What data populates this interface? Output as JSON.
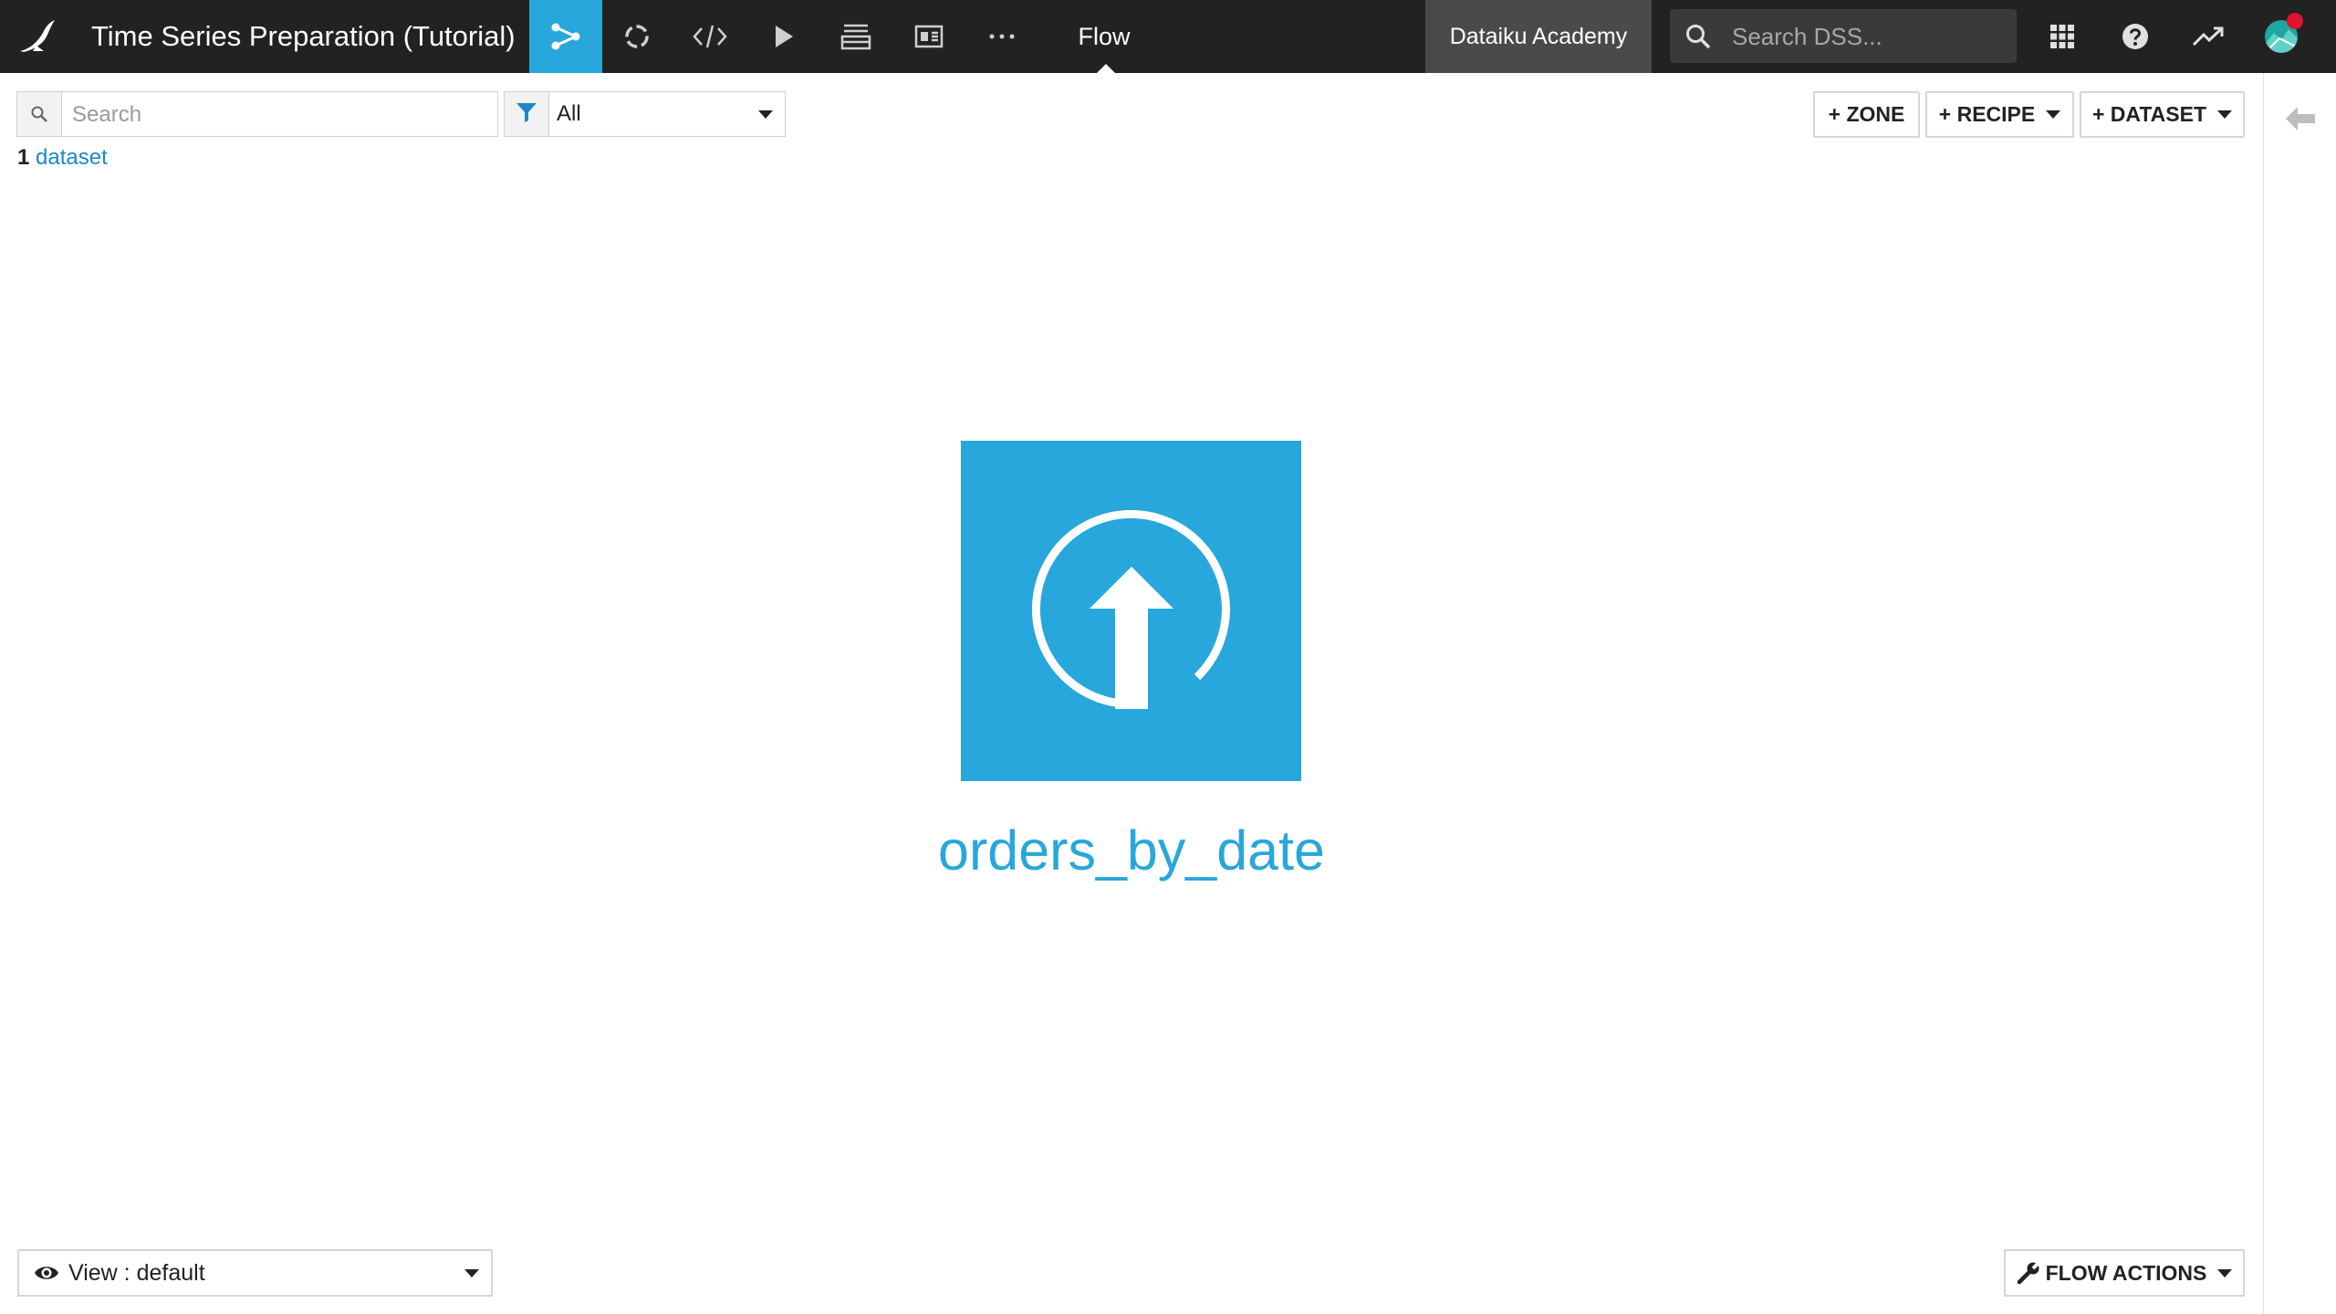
{
  "topbar": {
    "project_title": "Time Series Preparation (Tutorial)",
    "active_section_label": "Flow",
    "instance_label": "Dataiku Academy",
    "search_placeholder": "Search DSS..."
  },
  "toolbar": {
    "search_placeholder": "Search",
    "filter_value": "All",
    "count_number": "1",
    "count_label": "dataset",
    "zone_button": "+ ZONE",
    "recipe_button": "+ RECIPE",
    "dataset_button": "+ DATASET"
  },
  "flow": {
    "dataset_name": "orders_by_date",
    "dataset_icon": "upload-icon"
  },
  "footer": {
    "view_label": "View : default",
    "flow_actions_label": "FLOW ACTIONS"
  },
  "colors": {
    "topbar_bg": "#222222",
    "accent": "#27a7dc",
    "instance_bg": "#4a4a4a",
    "link": "#1f86c6",
    "notification": "#e0132c"
  }
}
